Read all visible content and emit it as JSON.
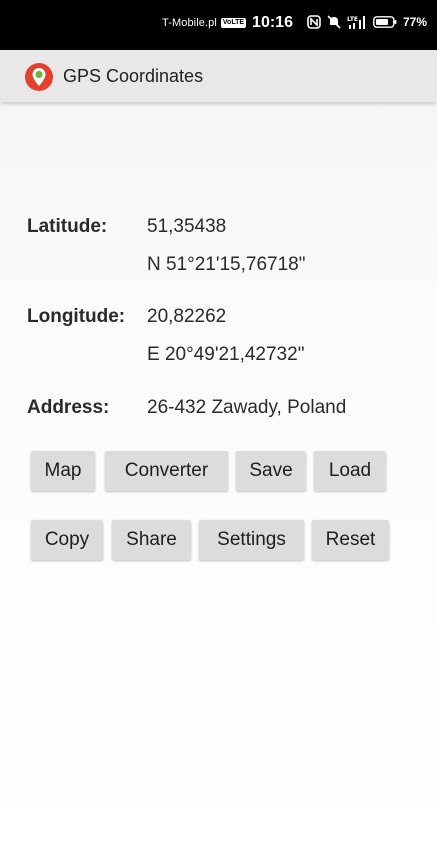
{
  "status_bar": {
    "carrier": "T-Mobile.pl",
    "volte_badge": "VoLTE",
    "time": "10:16",
    "network": "LTE",
    "battery": "77%"
  },
  "app_bar": {
    "title": "GPS Coordinates",
    "icon": "location-pin-icon"
  },
  "latitude": {
    "label": "Latitude:",
    "decimal": "51,35438",
    "dms": "N 51°21'15,76718\""
  },
  "longitude": {
    "label": "Longitude:",
    "decimal": "20,82262",
    "dms": "E 20°49'21,42732\""
  },
  "address": {
    "label": "Address:",
    "value": "26-432 Zawady, Poland"
  },
  "buttons": {
    "map": "Map",
    "converter": "Converter",
    "save": "Save",
    "load": "Load",
    "copy": "Copy",
    "share": "Share",
    "settings": "Settings",
    "reset": "Reset"
  },
  "colors": {
    "status_bar_bg": "#000000",
    "app_bar_bg": "#e8e8e8",
    "button_bg": "#dcdcdc",
    "pin_red": "#e5402b",
    "pin_green": "#6cb33f"
  }
}
